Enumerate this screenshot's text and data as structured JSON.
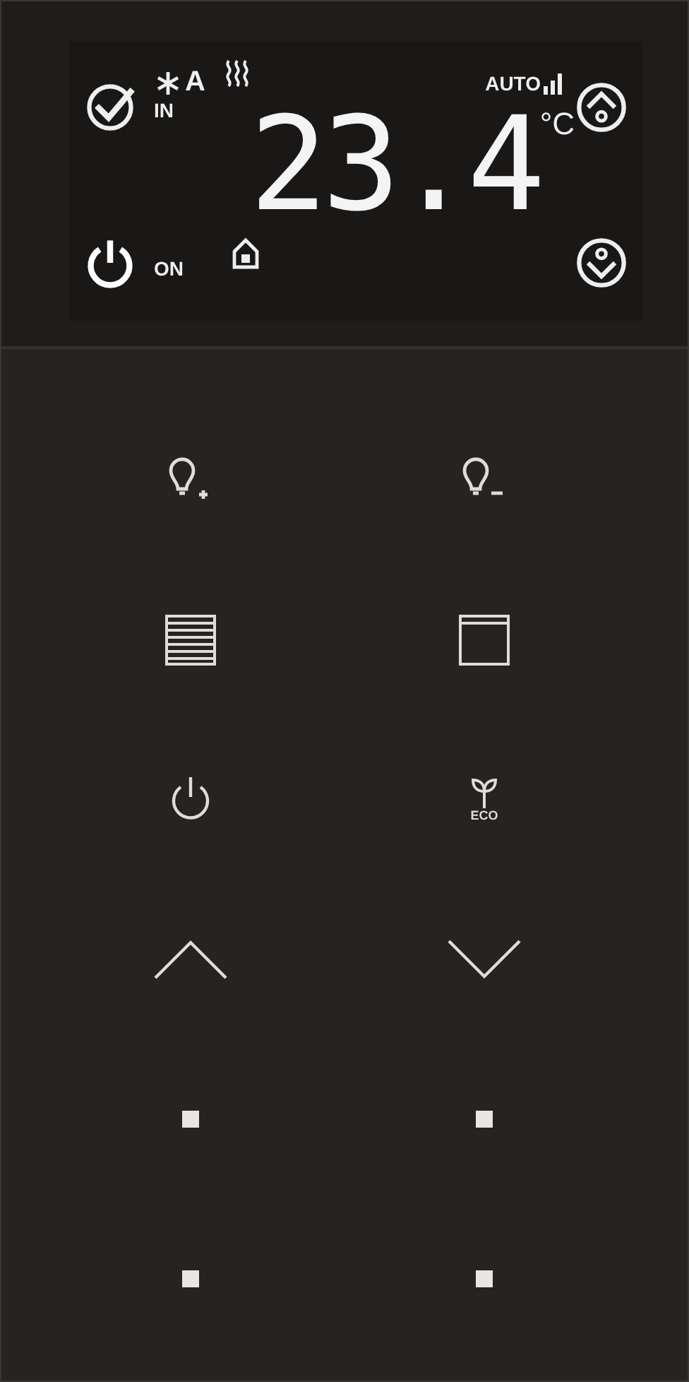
{
  "display": {
    "mode_in": "IN",
    "fan_auto": "A",
    "auto_label": "AUTO",
    "temperature": "23.4",
    "unit": "°C",
    "power_label": "ON"
  },
  "keys": [
    {
      "kind": "light-up"
    },
    {
      "kind": "light-down"
    },
    {
      "kind": "blind-closed"
    },
    {
      "kind": "blind-open"
    },
    {
      "kind": "power"
    },
    {
      "kind": "eco",
      "label": "ECO"
    },
    {
      "kind": "up"
    },
    {
      "kind": "down"
    },
    {
      "kind": "dot"
    },
    {
      "kind": "dot"
    },
    {
      "kind": "dot"
    },
    {
      "kind": "dot"
    }
  ]
}
